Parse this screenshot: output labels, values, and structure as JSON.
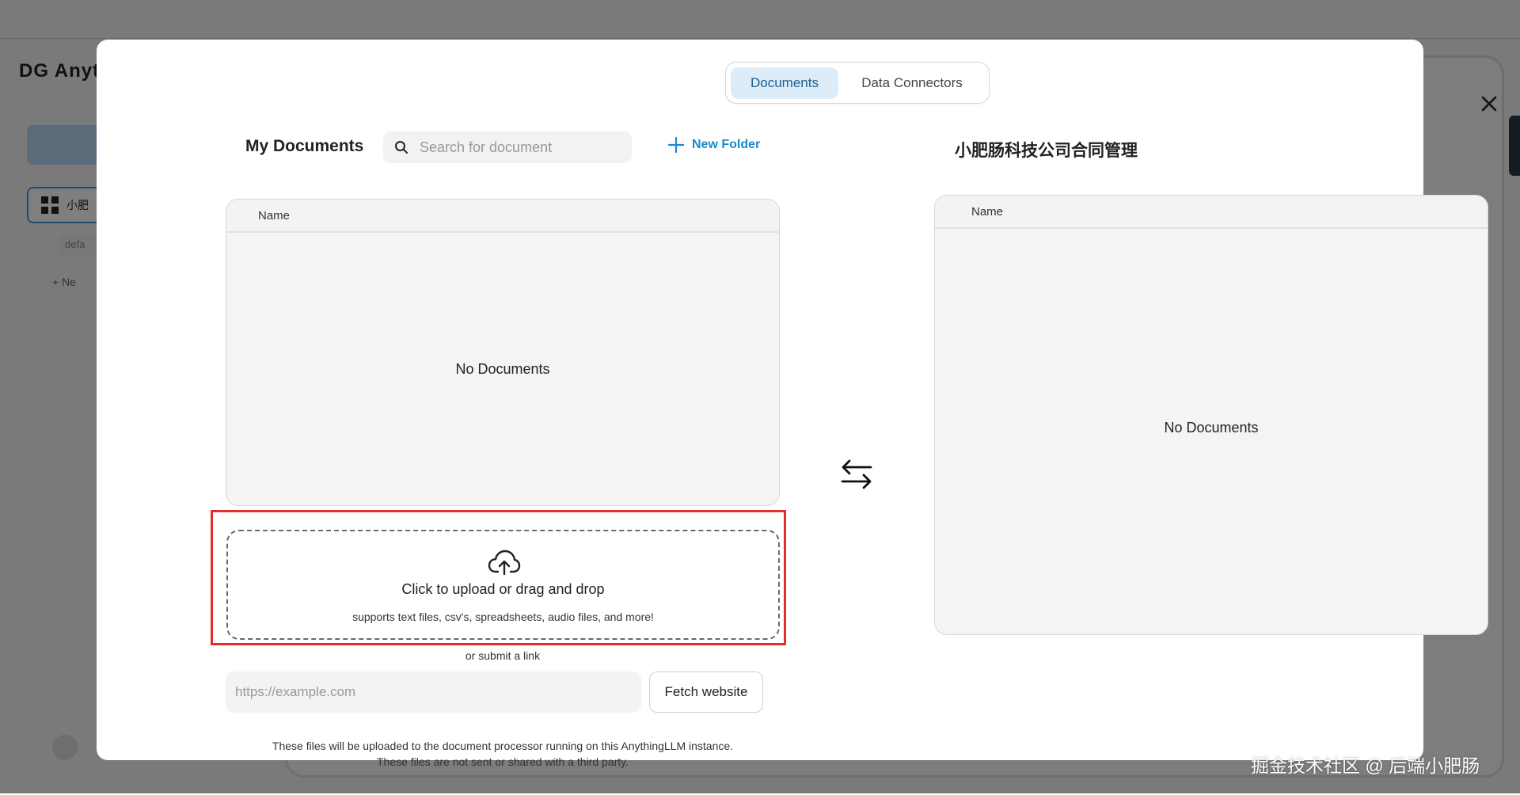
{
  "background": {
    "logo_text": "DG Anyth",
    "workspace_item": "小肥",
    "thread_item": "defa",
    "new_label": "+   Ne"
  },
  "modal": {
    "tabs": [
      {
        "label": "Documents",
        "active": true
      },
      {
        "label": "Data Connectors",
        "active": false
      }
    ],
    "left": {
      "title": "My Documents",
      "search_placeholder": "Search for document",
      "new_folder_label": "New Folder",
      "table_header": "Name",
      "empty_text": "No Documents"
    },
    "right": {
      "title": "小肥肠科技公司合同管理",
      "table_header": "Name",
      "empty_text": "No Documents"
    },
    "upload": {
      "title": "Click to upload or drag and drop",
      "subtitle": "supports text files, csv's, spreadsheets, audio files, and more!",
      "or_link": "or submit a link",
      "url_placeholder": "https://example.com",
      "fetch_label": "Fetch website",
      "disclaimer_line1": "These files will be uploaded to the document processor running on this AnythingLLM instance.",
      "disclaimer_line2": "These files are not sent or shared with a third party."
    }
  },
  "watermark": "掘金技术社区 @ 后端小肥肠",
  "colors": {
    "accent": "#1a8bc9",
    "active_tab_bg": "#dcecf8",
    "highlight": "#e0302a"
  }
}
